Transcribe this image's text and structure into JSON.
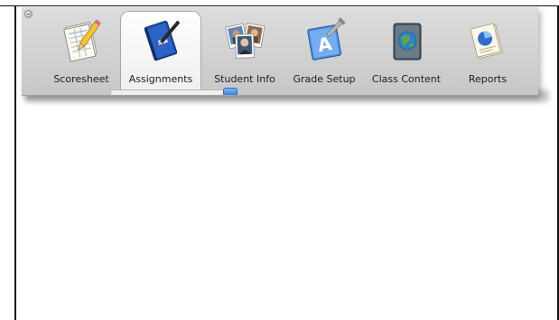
{
  "toolbar": {
    "tabs": [
      {
        "label": "Scoresheet",
        "icon": "scoresheet-icon",
        "selected": false
      },
      {
        "label": "Assignments",
        "icon": "assignments-notebook-icon",
        "selected": true
      },
      {
        "label": "Student Info",
        "icon": "student-photos-icon",
        "selected": false
      },
      {
        "label": "Grade Setup",
        "icon": "grade-setup-icon",
        "selected": false
      },
      {
        "label": "Class Content",
        "icon": "class-content-globe-icon",
        "selected": false
      },
      {
        "label": "Reports",
        "icon": "reports-chart-icon",
        "selected": false
      }
    ]
  },
  "colors": {
    "toolbar_bg": "#d0d0d0",
    "selected_tab_bg": "#f7f7f7",
    "accent_blue": "#3b83db"
  }
}
